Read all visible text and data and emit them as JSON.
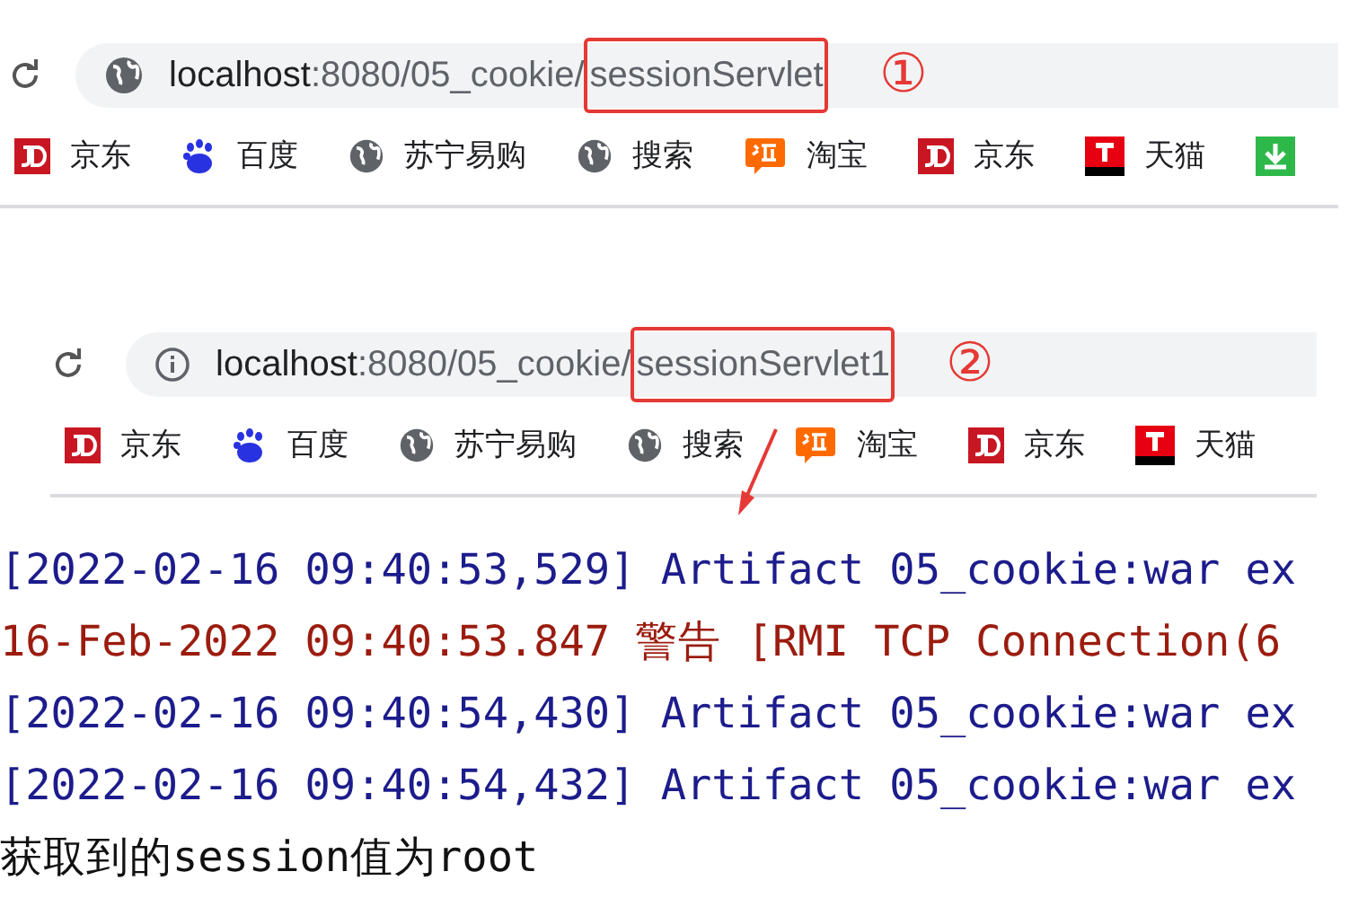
{
  "browser_windows": [
    {
      "security_icon": {
        "kind": "globe"
      },
      "url_host": "localhost",
      "url_path": ":8080/05_cookie/",
      "url_highlighted": "sessionServlet",
      "annotation": "①",
      "bookmarks": [
        {
          "kind": "jd",
          "label": "京东"
        },
        {
          "kind": "baidu",
          "label": "百度"
        },
        {
          "kind": "globe",
          "label": "苏宁易购"
        },
        {
          "kind": "globe",
          "label": "搜索"
        },
        {
          "kind": "taobao",
          "label": "淘宝"
        },
        {
          "kind": "jd",
          "label": "京东"
        },
        {
          "kind": "tmall",
          "label": "天猫"
        },
        {
          "kind": "download"
        }
      ]
    },
    {
      "security_icon": {
        "kind": "info"
      },
      "url_host": "localhost",
      "url_path": ":8080/05_cookie/",
      "url_highlighted": "sessionServlet1",
      "annotation": "②",
      "bookmarks": [
        {
          "kind": "jd",
          "label": "京东"
        },
        {
          "kind": "baidu",
          "label": "百度"
        },
        {
          "kind": "globe",
          "label": "苏宁易购"
        },
        {
          "kind": "globe",
          "label": "搜索"
        },
        {
          "kind": "taobao",
          "label": "淘宝"
        },
        {
          "kind": "jd",
          "label": "京东"
        },
        {
          "kind": "tmall",
          "label": "天猫"
        }
      ]
    }
  ],
  "console": {
    "lines": [
      {
        "kind": "info",
        "text": "[2022-02-16 09:40:53,529] Artifact 05_cookie:war ex"
      },
      {
        "kind": "warning",
        "text": "16-Feb-2022 09:40:53.847 警告 [RMI TCP Connection(6"
      },
      {
        "kind": "info",
        "text": "[2022-02-16 09:40:54,430] Artifact 05_cookie:war ex"
      },
      {
        "kind": "info",
        "text": "[2022-02-16 09:40:54,432] Artifact 05_cookie:war ex"
      },
      {
        "kind": "output",
        "text": "获取到的session值为root"
      }
    ]
  }
}
